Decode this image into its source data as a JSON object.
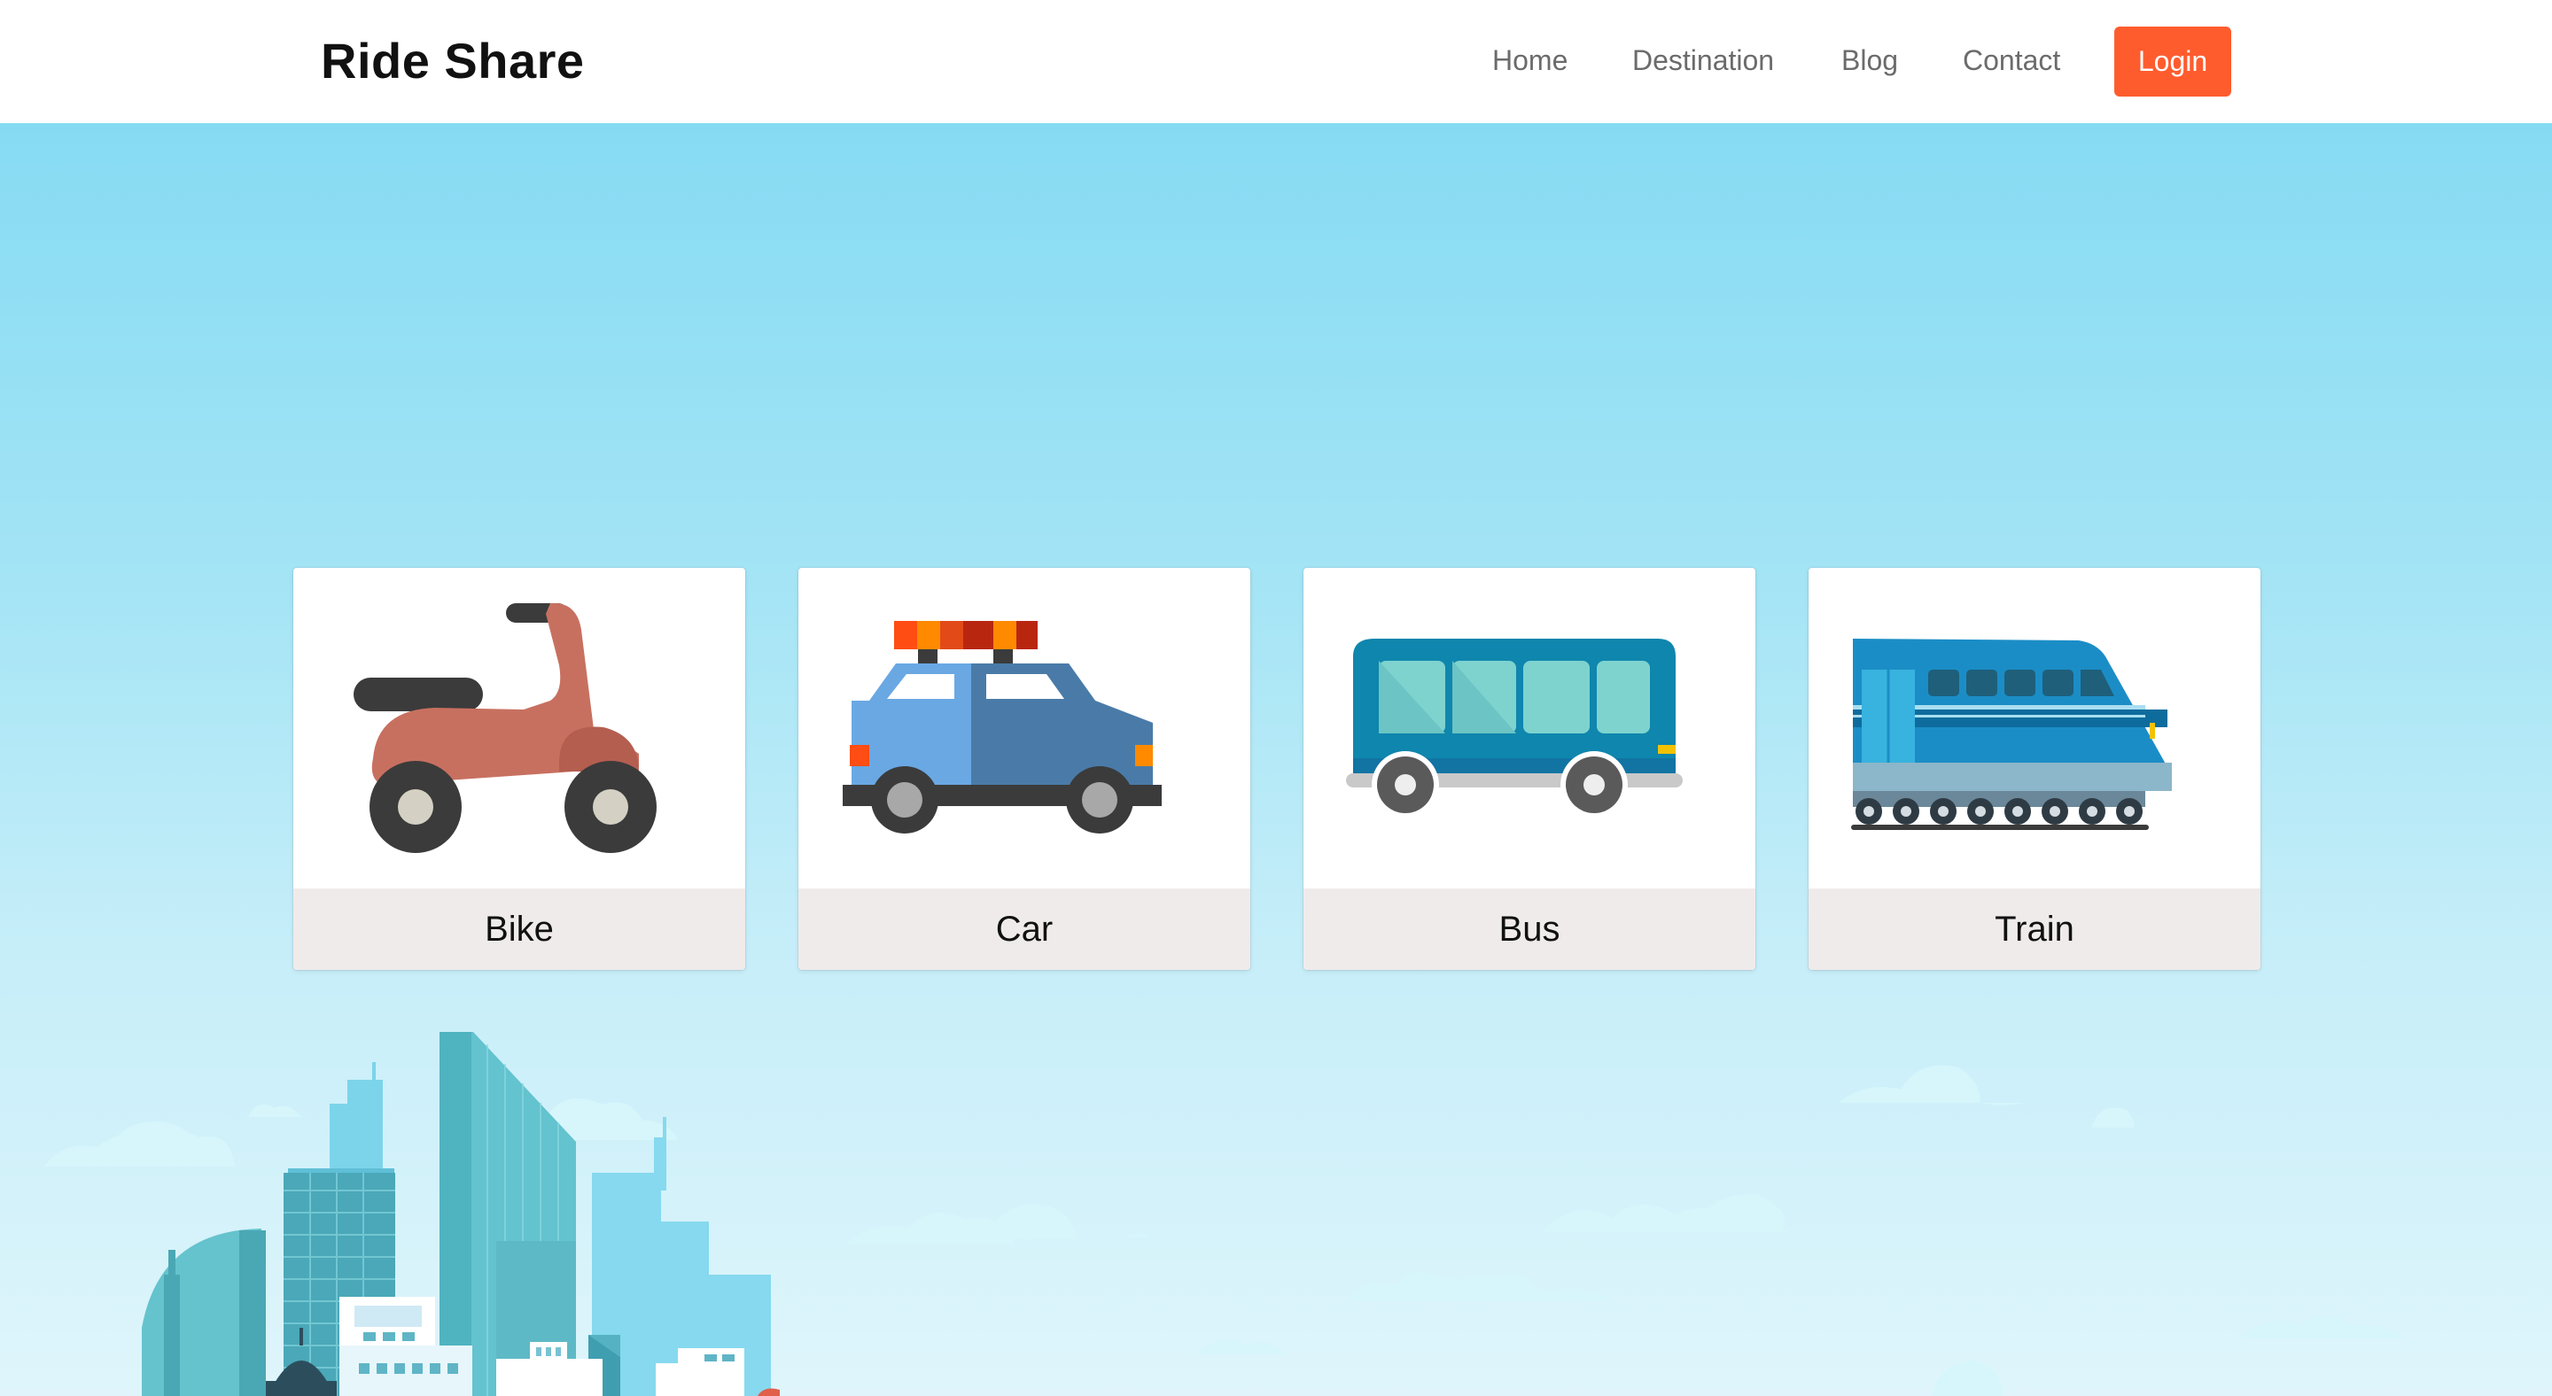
{
  "header": {
    "brand": "Ride Share",
    "nav": [
      "Home",
      "Destination",
      "Blog",
      "Contact"
    ],
    "login_label": "Login"
  },
  "vehicles": [
    {
      "label": "Bike",
      "icon": "scooter-icon"
    },
    {
      "label": "Car",
      "icon": "car-icon"
    },
    {
      "label": "Bus",
      "icon": "bus-icon"
    },
    {
      "label": "Train",
      "icon": "train-icon"
    }
  ],
  "colors": {
    "accent": "#ff5c2e",
    "sky_top": "#86dbf3",
    "sky_bottom": "#dff5fb",
    "card_footer": "#f0ebeb"
  }
}
